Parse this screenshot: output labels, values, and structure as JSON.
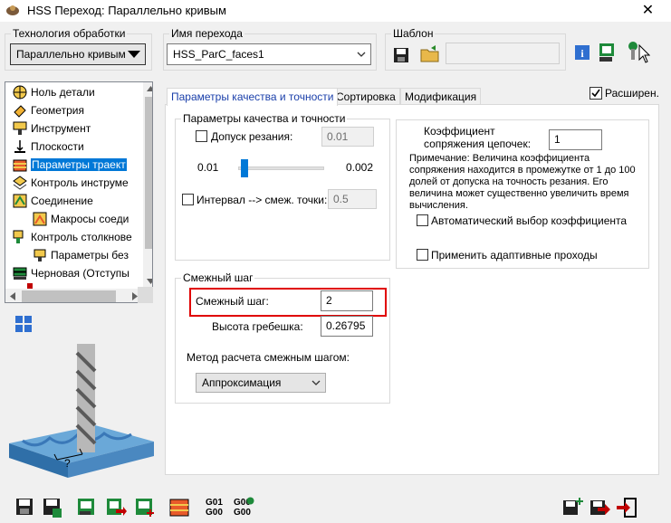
{
  "window": {
    "title": "HSS Переход: Параллельно кривым",
    "close_label": "✕"
  },
  "technology": {
    "legend": "Технология обработки",
    "value": "Параллельно кривым"
  },
  "step_name": {
    "legend": "Имя перехода",
    "value": "HSS_ParC_faces1"
  },
  "template": {
    "legend": "Шаблон",
    "value": ""
  },
  "tree": {
    "items": [
      {
        "label": "Ноль детали"
      },
      {
        "label": "Геометрия"
      },
      {
        "label": "Инструмент"
      },
      {
        "label": "Плоскости"
      },
      {
        "label": "Параметры траект"
      },
      {
        "label": "Контроль инструме"
      },
      {
        "label": "Соединение"
      },
      {
        "label": "Макросы соеди"
      },
      {
        "label": "Контроль столкнове"
      },
      {
        "label": "Параметры без"
      },
      {
        "label": "Черновая (Отступы"
      }
    ]
  },
  "tabs": [
    {
      "label": "Параметры качества и точности"
    },
    {
      "label": "Сортировка"
    },
    {
      "label": "Модификация"
    }
  ],
  "extended": {
    "label": "Расширен.",
    "checked": true
  },
  "quality": {
    "legend": "Параметры качества и точности",
    "tolerance_label": "Допуск резания:",
    "tolerance_value": "0.01",
    "slider_min": "0.01",
    "slider_max": "0.002",
    "interval_label": "Интервал --> смеж. точки:",
    "interval_value": "0.5"
  },
  "coef": {
    "label": "Коэффициент сопряжения цепочек:",
    "value": "1",
    "note": "Примечание: Величина коэффициента сопряжения находится в промежутке от 1 до 100 долей от допуска на точность резания. Его величина может существенно  увеличить время вычисления.",
    "auto_label": "Автоматический выбор коэффициента",
    "adaptive_label": "Применить адаптивные проходы"
  },
  "stepover": {
    "legend": "Смежный шаг",
    "step_label": "Смежный шаг:",
    "step_value": "2",
    "scallop_label": "Высота гребешка:",
    "scallop_value": "0.26795",
    "method_label": "Метод расчета смежным шагом:",
    "method_value": "Аппроксимация"
  },
  "preview": {
    "question": "?"
  },
  "bottom_toolbar": {
    "g01": "G01",
    "g00": "G00",
    "g00b": "G00",
    "g00c": "G00"
  }
}
